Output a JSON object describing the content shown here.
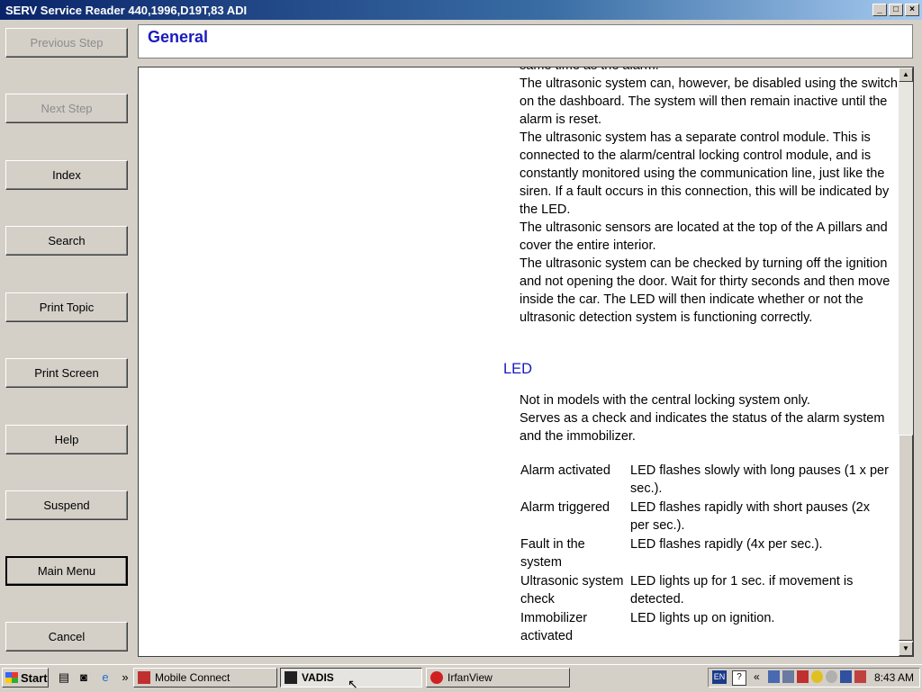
{
  "window": {
    "title": "SERV Service Reader 440,1996,D19T,83 ADI",
    "controls": [
      "_",
      "□",
      "×"
    ]
  },
  "nav": {
    "previous_step": "Previous Step",
    "next_step": "Next Step",
    "index": "Index",
    "search": "Search",
    "print_topic": "Print Topic",
    "print_screen": "Print Screen",
    "help": "Help",
    "suspend": "Suspend",
    "main_menu": "Main Menu",
    "cancel": "Cancel"
  },
  "header": {
    "title": "General"
  },
  "content": {
    "paragraphs": [
      "same time as the alarm.",
      "The ultrasonic system can, however, be disabled using the switch on the dashboard. The system will then remain inactive until the alarm is reset.",
      "The ultrasonic system has a separate control module. This is connected to the alarm/central locking control module, and is constantly monitored using the communication line, just like the siren. If a fault occurs in this connection, this will be indicated by the LED.",
      "The ultrasonic sensors are located at the top of the A pillars and cover the entire interior.",
      "The ultrasonic system can be checked by turning off the ignition and not opening the door. Wait for thirty seconds and then move inside the car. The LED will then indicate whether or not the ultrasonic detection system is functioning correctly."
    ],
    "led_heading": "LED",
    "led_paragraphs": [
      "Not in models with the central locking system only.",
      "Serves as a check and indicates the status of the alarm system and the immobilizer."
    ],
    "led_table": [
      {
        "state": "Alarm activated",
        "description": "LED flashes slowly with long pauses (1 x per sec.)."
      },
      {
        "state": "Alarm triggered",
        "description": "LED flashes rapidly with short pauses (2x per sec.)."
      },
      {
        "state": "Fault in the system",
        "description": "LED flashes rapidly (4x per sec.)."
      },
      {
        "state": "Ultrasonic system check",
        "description": "LED lights up for 1 sec. if movement is detected."
      },
      {
        "state": "Immobilizer activated",
        "description": "LED lights up on ignition."
      }
    ]
  },
  "taskbar": {
    "start": "Start",
    "tasks": [
      {
        "label": "Mobile Connect"
      },
      {
        "label": "VADIS"
      },
      {
        "label": "IrfanView"
      }
    ],
    "language": "EN",
    "clock": "8:43 AM",
    "overflow": "»",
    "tray_overflow": "«"
  },
  "colors": {
    "accent": "#1a1ac0",
    "titlebar": "#0a246a"
  }
}
